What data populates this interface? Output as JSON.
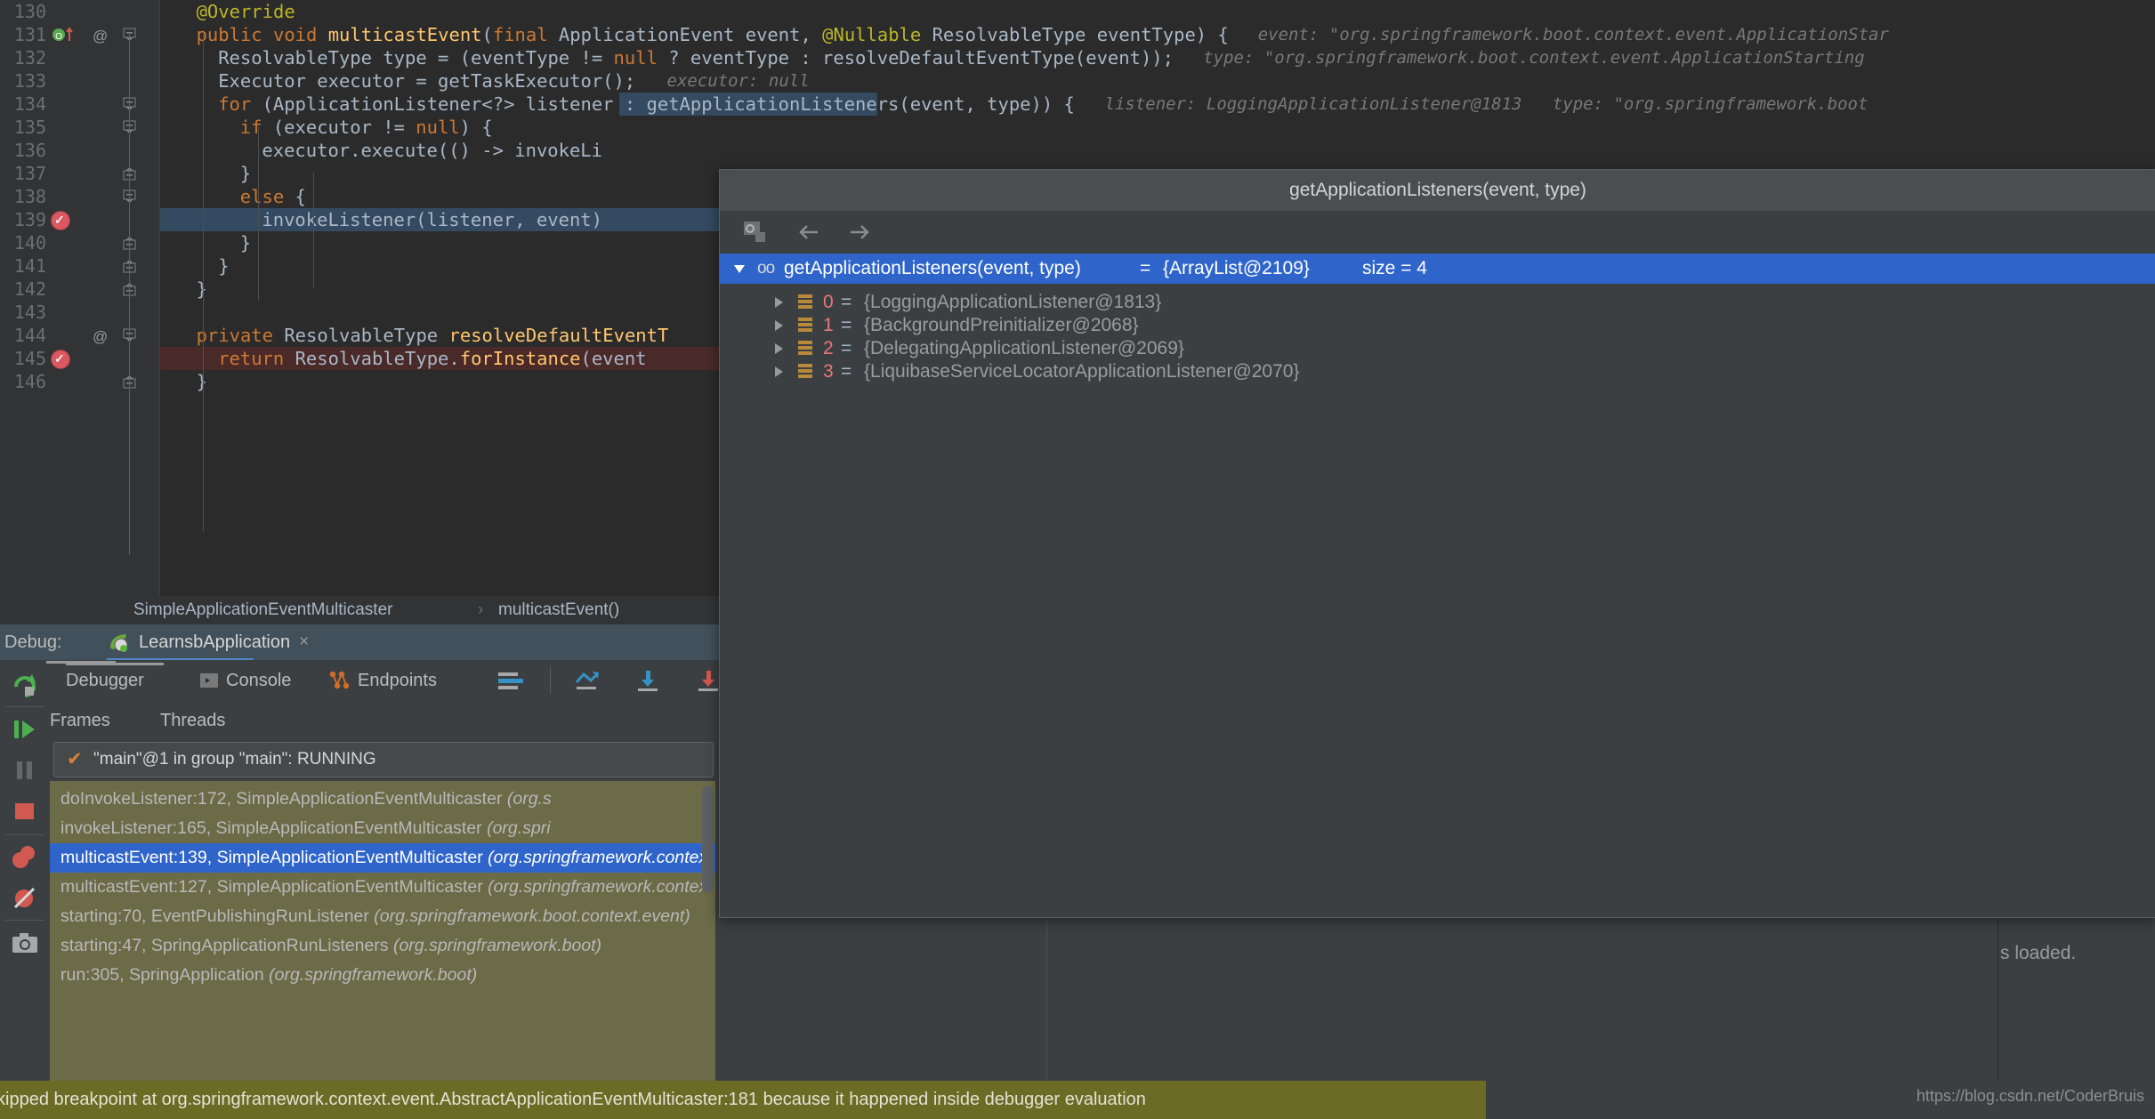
{
  "editor": {
    "lines": [
      {
        "num": "130",
        "indent": 2,
        "tokens": [
          {
            "t": "@Override",
            "c": "an"
          }
        ]
      },
      {
        "num": "131",
        "indent": 2,
        "tokens": [
          {
            "t": "public ",
            "c": "kw"
          },
          {
            "t": "void ",
            "c": "kw"
          },
          {
            "t": "multicastEvent",
            "c": "mn"
          },
          {
            "t": "(",
            "c": "id"
          },
          {
            "t": "final ",
            "c": "kw"
          },
          {
            "t": "ApplicationEvent event, ",
            "c": "id"
          },
          {
            "t": "@Nullable",
            "c": "an"
          },
          {
            "t": " ResolvableType eventType) {",
            "c": "id"
          }
        ],
        "hint": "event: \"org.springframework.boot.context.event.ApplicationStar"
      },
      {
        "num": "132",
        "indent": 4,
        "tokens": [
          {
            "t": "ResolvableType type = (eventType != ",
            "c": "id"
          },
          {
            "t": "null ",
            "c": "kw"
          },
          {
            "t": "? eventType : resolveDefaultEventType(event));",
            "c": "id"
          }
        ],
        "hint": "type: \"org.springframework.boot.context.event.ApplicationStarting"
      },
      {
        "num": "133",
        "indent": 4,
        "tokens": [
          {
            "t": "Executor executor = getTaskExecutor();",
            "c": "id"
          }
        ],
        "hint": "executor: null"
      },
      {
        "num": "134",
        "indent": 4,
        "tokens": [
          {
            "t": "for ",
            "c": "kw"
          },
          {
            "t": "(ApplicationListener<?> listener : getApplicationListeners(event, type)) {",
            "c": "id"
          }
        ],
        "hint": "listener: LoggingApplicationListener@1813   type: \"org.springframework.boot"
      },
      {
        "num": "135",
        "indent": 6,
        "tokens": [
          {
            "t": "if ",
            "c": "kw"
          },
          {
            "t": "(executor != ",
            "c": "id"
          },
          {
            "t": "null",
            "c": "kw"
          },
          {
            "t": ") {",
            "c": "id"
          }
        ]
      },
      {
        "num": "136",
        "indent": 8,
        "tokens": [
          {
            "t": "executor.execute(() -> invokeLi",
            "c": "id"
          }
        ]
      },
      {
        "num": "137",
        "indent": 6,
        "tokens": [
          {
            "t": "}",
            "c": "id"
          }
        ]
      },
      {
        "num": "138",
        "indent": 6,
        "tokens": [
          {
            "t": "else ",
            "c": "kw"
          },
          {
            "t": "{",
            "c": "id"
          }
        ]
      },
      {
        "num": "139",
        "indent": 8,
        "tokens": [
          {
            "t": "invokeListener(listener, event)",
            "c": "id"
          }
        ]
      },
      {
        "num": "140",
        "indent": 6,
        "tokens": [
          {
            "t": "}",
            "c": "id"
          }
        ]
      },
      {
        "num": "141",
        "indent": 4,
        "tokens": [
          {
            "t": "}",
            "c": "id"
          }
        ]
      },
      {
        "num": "142",
        "indent": 2,
        "tokens": [
          {
            "t": "}",
            "c": "id"
          }
        ]
      },
      {
        "num": "143",
        "indent": 0,
        "tokens": []
      },
      {
        "num": "144",
        "indent": 2,
        "tokens": [
          {
            "t": "private ",
            "c": "kw"
          },
          {
            "t": "ResolvableType ",
            "c": "id"
          },
          {
            "t": "resolveDefaultEventT",
            "c": "mn"
          }
        ]
      },
      {
        "num": "145",
        "indent": 4,
        "tokens": [
          {
            "t": "return ",
            "c": "kw"
          },
          {
            "t": "ResolvableType.",
            "c": "id"
          },
          {
            "t": "forInstance",
            "c": "fn"
          },
          {
            "t": "(event",
            "c": "id"
          }
        ]
      },
      {
        "num": "146",
        "indent": 2,
        "tokens": [
          {
            "t": "}",
            "c": "id"
          }
        ]
      }
    ]
  },
  "breadcrumb": {
    "class_name": "SimpleApplicationEventMulticaster",
    "separator": "›",
    "method_name": "multicastEvent()"
  },
  "debug": {
    "label": "Debug:",
    "run_config": "LearnsbApplication",
    "close_label": "×",
    "tabs": [
      {
        "label": "Debugger",
        "icon": "none"
      },
      {
        "label": "Console",
        "icon": "console-icon"
      },
      {
        "label": "Endpoints",
        "icon": "endpoints-icon"
      }
    ],
    "frames_tabs": [
      {
        "label": "Frames"
      },
      {
        "label": "Threads"
      }
    ],
    "thread_status": "\"main\"@1 in group \"main\": RUNNING",
    "thread_check": "✔",
    "frames": [
      {
        "text": "doInvokeListener:172, SimpleApplicationEventMulticaster ",
        "pkg": "(org.s",
        "selected": false
      },
      {
        "text": "invokeListener:165, SimpleApplicationEventMulticaster ",
        "pkg": "(org.spri",
        "selected": false
      },
      {
        "text": "multicastEvent:139, SimpleApplicationEventMulticaster ",
        "pkg": "(org.springframework.contex",
        "selected": true
      },
      {
        "text": "multicastEvent:127, SimpleApplicationEventMulticaster ",
        "pkg": "(org.springframework.context",
        "selected": false
      },
      {
        "text": "starting:70, EventPublishingRunListener ",
        "pkg": "(org.springframework.boot.context.event)",
        "selected": false
      },
      {
        "text": "starting:47, SpringApplicationRunListeners ",
        "pkg": "(org.springframework.boot)",
        "selected": false
      },
      {
        "text": "run:305, SpringApplication ",
        "pkg": "(org.springframework.boot)",
        "selected": false
      }
    ],
    "variables": [
      {
        "name": "executor",
        "eq": " = ",
        "value": "null",
        "kind": "null",
        "expandable": false
      },
      {
        "name": "listener",
        "eq": " = ",
        "value": "{LoggingApplicationListener@1813}",
        "kind": "obj",
        "expandable": true
      }
    ],
    "console_tail": "s loaded."
  },
  "popup": {
    "title": "getApplicationListeners(event, type)",
    "toolbar_icons": [
      "copy-value-icon",
      "back-arrow-icon",
      "forward-arrow-icon"
    ],
    "root": {
      "label": "getApplicationListeners(event, type)",
      "eq": " = ",
      "value": "{ArrayList@2109}",
      "size": "size = 4"
    },
    "children": [
      {
        "index": "0",
        "eq": " = ",
        "value": "{LoggingApplicationListener@1813}"
      },
      {
        "index": "1",
        "eq": " = ",
        "value": "{BackgroundPreinitializer@2068}"
      },
      {
        "index": "2",
        "eq": " = ",
        "value": "{DelegatingApplicationListener@2069}"
      },
      {
        "index": "3",
        "eq": " = ",
        "value": "{LiquibaseServiceLocatorApplicationListener@2070}"
      }
    ]
  },
  "notification": {
    "text": "kipped breakpoint at org.springframework.context.event.AbstractApplicationEventMulticaster:181 because it happened inside debugger evaluation"
  },
  "watermark": {
    "text": "https://blog.csdn.net/CoderBruis"
  },
  "colors": {
    "editor_bg": "#2b2b2b",
    "gutter_bg": "#313335",
    "panel_bg": "#3c3f41",
    "selection_blue": "#2f65ca",
    "current_line": "#344a60",
    "breakpoint_line": "#4a2a29",
    "frames_bg": "#6b6b48",
    "notify_bg": "#6b6b26",
    "accent_blue": "#4a88c7"
  }
}
